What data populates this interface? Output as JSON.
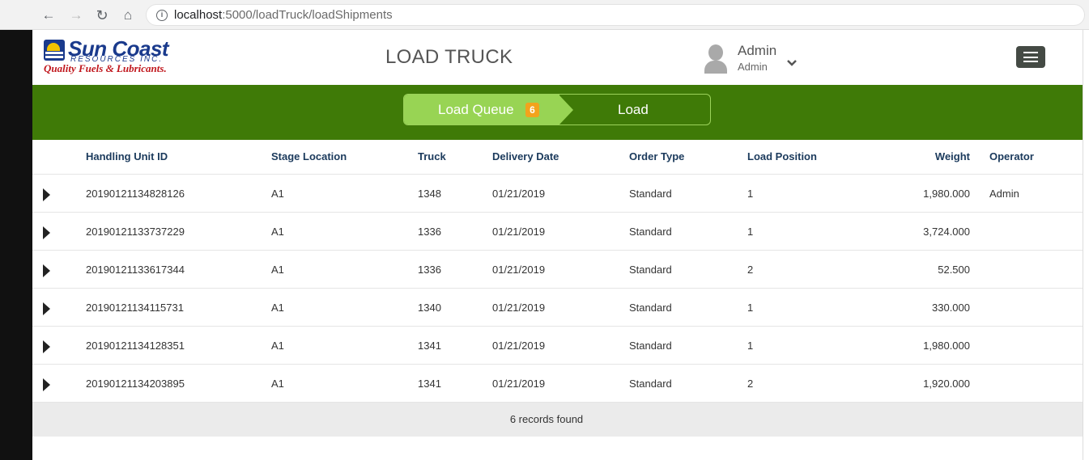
{
  "browser": {
    "url_host": "localhost",
    "url_path": ":5000/loadTruck/loadShipments"
  },
  "brand": {
    "logo_line1": "Sun Coast",
    "logo_line2": "RESOURCES INC.",
    "logo_line3": "Quality Fuels & Lubricants."
  },
  "header": {
    "title": "LOAD TRUCK",
    "user_name": "Admin",
    "user_role": "Admin"
  },
  "steps": {
    "queue_label": "Load Queue",
    "queue_count": "6",
    "load_label": "Load"
  },
  "table": {
    "columns": [
      "Handling Unit ID",
      "Stage Location",
      "Truck",
      "Delivery Date",
      "Order Type",
      "Load Position",
      "Weight",
      "Operator"
    ],
    "rows": [
      [
        "20190121134828126",
        "A1",
        "1348",
        "01/21/2019",
        "Standard",
        "1",
        "1,980.000",
        "Admin"
      ],
      [
        "20190121133737229",
        "A1",
        "1336",
        "01/21/2019",
        "Standard",
        "1",
        "3,724.000",
        ""
      ],
      [
        "20190121133617344",
        "A1",
        "1336",
        "01/21/2019",
        "Standard",
        "2",
        "52.500",
        ""
      ],
      [
        "20190121134115731",
        "A1",
        "1340",
        "01/21/2019",
        "Standard",
        "1",
        "330.000",
        ""
      ],
      [
        "20190121134128351",
        "A1",
        "1341",
        "01/21/2019",
        "Standard",
        "1",
        "1,980.000",
        ""
      ],
      [
        "20190121134203895",
        "A1",
        "1341",
        "01/21/2019",
        "Standard",
        "2",
        "1,920.000",
        ""
      ]
    ],
    "footer": "6 records found"
  },
  "colors": {
    "green_bar": "#3f7a07",
    "step_active": "#98d454",
    "badge": "#f2a31c",
    "header_text": "#1b3a5c"
  }
}
